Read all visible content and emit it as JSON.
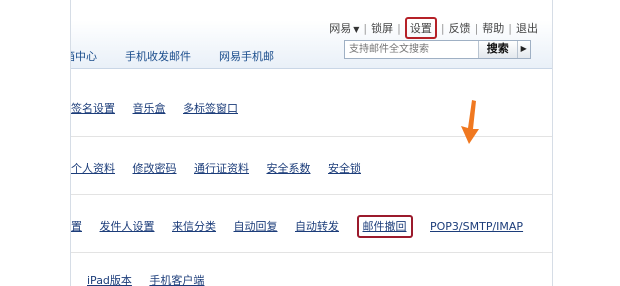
{
  "topnav": {
    "items": [
      "网易",
      "锁屏",
      "设置",
      "反馈",
      "帮助",
      "退出"
    ]
  },
  "subnav": {
    "tabs": [
      "邮箱中心",
      "手机收发邮件",
      "网易手机邮"
    ]
  },
  "search": {
    "placeholder": "支持邮件全文搜索",
    "button": "搜索"
  },
  "rows": {
    "r1": [
      "签名设置",
      "音乐盒",
      "多标签窗口"
    ],
    "r2": [
      "个人资料",
      "修改密码",
      "通行证资料",
      "安全系数",
      "安全锁"
    ],
    "r3": [
      "置",
      "发件人设置",
      "来信分类",
      "自动回复",
      "自动转发",
      "邮件撤回",
      "POP3/SMTP/IMAP"
    ],
    "r4": [
      "iPad版本",
      "手机客户端"
    ]
  },
  "colors": {
    "highlight": "#b52128",
    "arrow": "#f07820",
    "link": "#1c3d7a"
  }
}
